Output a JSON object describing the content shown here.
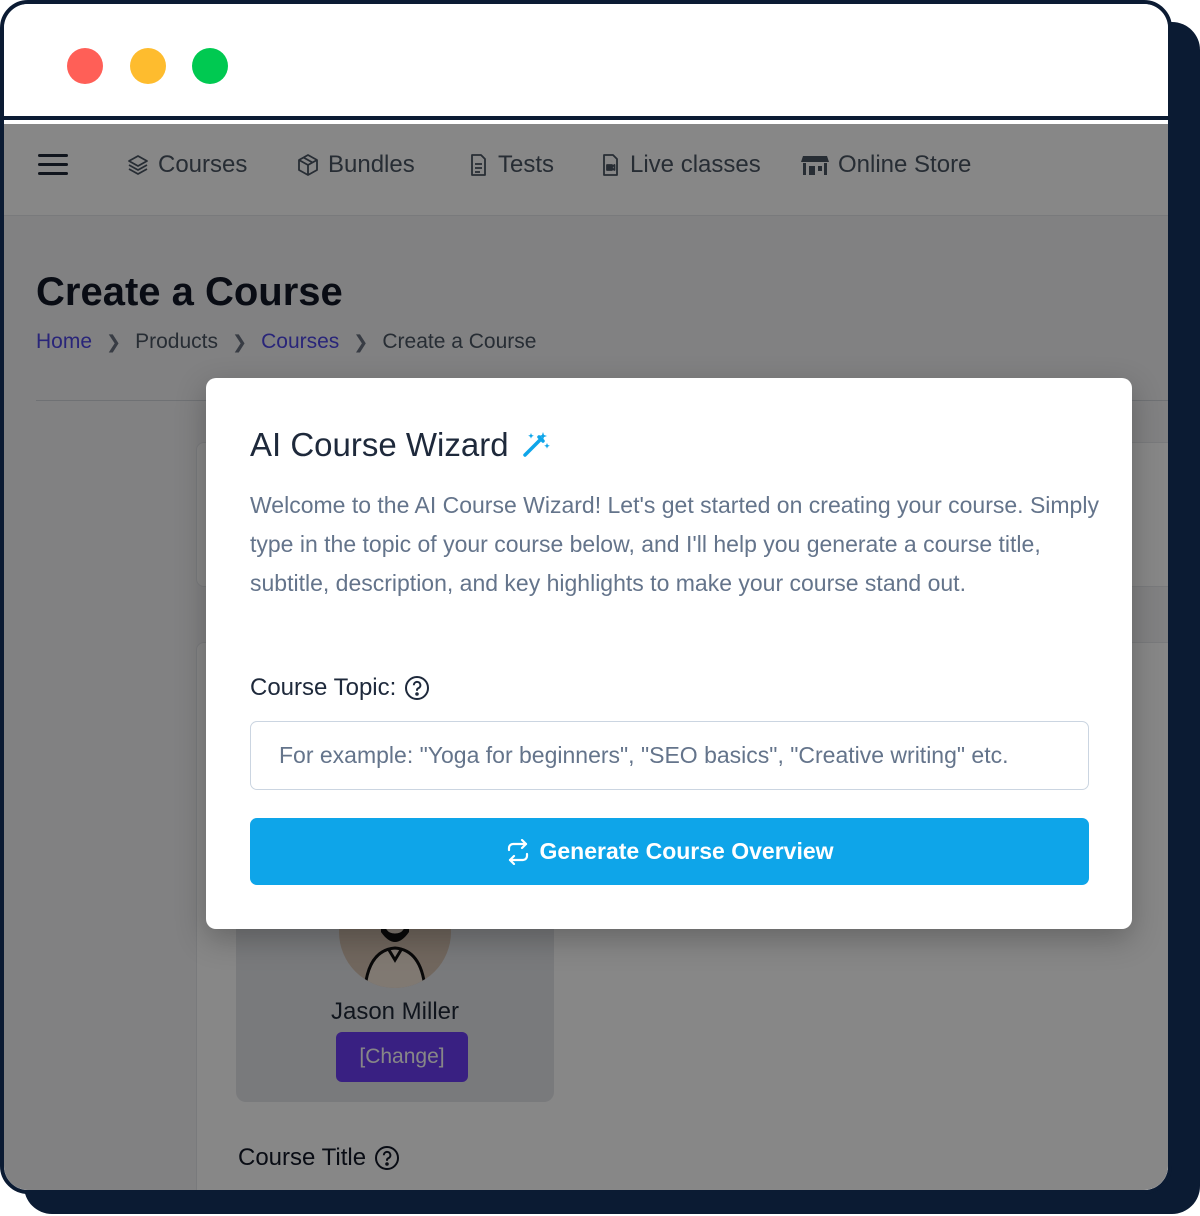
{
  "nav": {
    "items": [
      {
        "label": "Courses",
        "icon": "layers-icon"
      },
      {
        "label": "Bundles",
        "icon": "box-icon"
      },
      {
        "label": "Tests",
        "icon": "document-icon"
      },
      {
        "label": "Live classes",
        "icon": "video-file-icon"
      },
      {
        "label": "Online Store",
        "icon": "store-icon"
      }
    ]
  },
  "page": {
    "title": "Create a Course",
    "breadcrumb": [
      "Home",
      "Products",
      "Courses",
      "Create a Course"
    ]
  },
  "instructor": {
    "name": "Jason Miller",
    "change_label": "[Change]"
  },
  "form": {
    "course_title_label": "Course Title"
  },
  "modal": {
    "title": "AI Course Wizard",
    "description": "Welcome to the AI Course Wizard! Let's get started on creating your course. Simply type in the topic of your course below, and I'll help you generate a course title, subtitle, description, and key highlights to make your course stand out.",
    "topic_label": "Course Topic:",
    "topic_placeholder": "For example: \"Yoga for beginners\", \"SEO basics\", \"Creative writing\" etc.",
    "generate_label": "Generate Course Overview"
  },
  "colors": {
    "accent": "#0ea5e9",
    "link": "#4f46e5",
    "change_button": "#6d3df5",
    "window_frame": "#0b1b33"
  }
}
